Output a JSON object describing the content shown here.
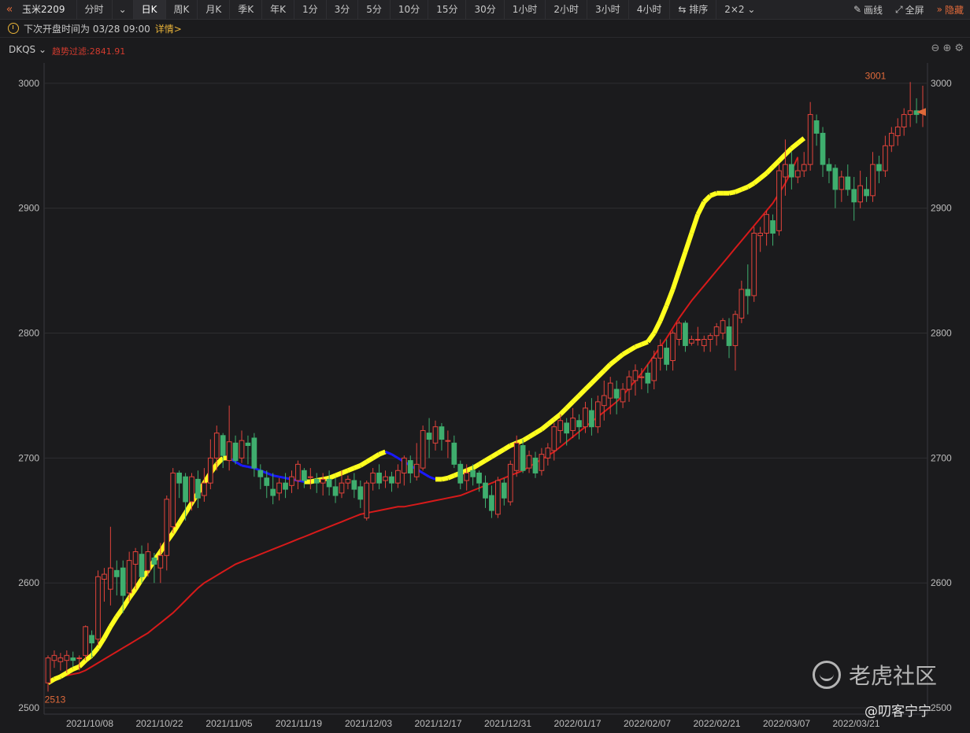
{
  "toolbar": {
    "symbol": "玉米2209",
    "tabs": [
      {
        "label": "分时"
      },
      {
        "label": "日K"
      },
      {
        "label": "周K"
      },
      {
        "label": "月K"
      },
      {
        "label": "季K"
      },
      {
        "label": "年K"
      },
      {
        "label": "1分"
      },
      {
        "label": "3分"
      },
      {
        "label": "5分"
      },
      {
        "label": "10分"
      },
      {
        "label": "15分"
      },
      {
        "label": "30分"
      },
      {
        "label": "1小时"
      },
      {
        "label": "2小时"
      },
      {
        "label": "3小时"
      },
      {
        "label": "4小时"
      },
      {
        "label": "排序"
      },
      {
        "label": "2×2"
      }
    ],
    "active_tab": "日K",
    "draw_label": "画线",
    "fullscreen_label": "全屏",
    "hide_label": "隐藏"
  },
  "info_bar": {
    "next_open": "下次开盘时间为 03/28 09:00",
    "detail_link": "详情>"
  },
  "indicator": {
    "name": "DKQS",
    "trend_filter": "趋势过滤:2841.91"
  },
  "watermark": {
    "brand": "老虎社区",
    "user": "@叨客宁宁"
  },
  "colors": {
    "up": "#e2433b",
    "down": "#3fae6e",
    "ma": "#d71a1a",
    "trend_up": "#ffff1e",
    "trend_down": "#1a1aff",
    "grid": "#2e2e31",
    "accent": "#e06a3a"
  },
  "chart_data": {
    "type": "candlestick",
    "y_ticks": [
      2500,
      2600,
      2700,
      2800,
      2900,
      3000
    ],
    "ylim": [
      2495,
      3010
    ],
    "x_tick_labels": [
      "2021/10/08",
      "2021/10/22",
      "2021/11/05",
      "2021/11/19",
      "2021/12/03",
      "2021/12/17",
      "2021/12/31",
      "2022/01/17",
      "2022/02/07",
      "2022/02/21",
      "2022/03/07",
      "2022/03/21"
    ],
    "high_label": "3001",
    "low_label": "2513",
    "last_price": 2977,
    "candles": [
      [
        2520,
        2540,
        2513,
        2542
      ],
      [
        2538,
        2542,
        2532,
        2546
      ],
      [
        2537,
        2540,
        2530,
        2544
      ],
      [
        2538,
        2542,
        2528,
        2546
      ],
      [
        2540,
        2538,
        2533,
        2545
      ],
      [
        2540,
        2540,
        2530,
        2542
      ],
      [
        2542,
        2565,
        2538,
        2566
      ],
      [
        2558,
        2552,
        2540,
        2562
      ],
      [
        2555,
        2605,
        2550,
        2610
      ],
      [
        2603,
        2607,
        2585,
        2612
      ],
      [
        2595,
        2612,
        2582,
        2645
      ],
      [
        2610,
        2605,
        2590,
        2618
      ],
      [
        2612,
        2590,
        2576,
        2618
      ],
      [
        2592,
        2618,
        2585,
        2625
      ],
      [
        2615,
        2625,
        2595,
        2628
      ],
      [
        2623,
        2605,
        2600,
        2630
      ],
      [
        2610,
        2625,
        2605,
        2632
      ],
      [
        2620,
        2615,
        2600,
        2624
      ],
      [
        2612,
        2622,
        2600,
        2632
      ],
      [
        2622,
        2667,
        2610,
        2670
      ],
      [
        2645,
        2688,
        2640,
        2692
      ],
      [
        2688,
        2680,
        2668,
        2690
      ],
      [
        2685,
        2665,
        2650,
        2688
      ],
      [
        2665,
        2685,
        2658,
        2688
      ],
      [
        2683,
        2668,
        2660,
        2690
      ],
      [
        2670,
        2680,
        2665,
        2692
      ],
      [
        2680,
        2700,
        2675,
        2715
      ],
      [
        2700,
        2720,
        2690,
        2726
      ],
      [
        2718,
        2702,
        2692,
        2720
      ],
      [
        2698,
        2713,
        2690,
        2742
      ],
      [
        2712,
        2698,
        2695,
        2718
      ],
      [
        2700,
        2714,
        2696,
        2722
      ],
      [
        2712,
        2710,
        2695,
        2718
      ],
      [
        2716,
        2692,
        2685,
        2720
      ],
      [
        2690,
        2685,
        2675,
        2695
      ],
      [
        2684,
        2678,
        2668,
        2690
      ],
      [
        2675,
        2670,
        2663,
        2688
      ],
      [
        2672,
        2680,
        2666,
        2684
      ],
      [
        2680,
        2675,
        2668,
        2688
      ],
      [
        2678,
        2685,
        2672,
        2690
      ],
      [
        2682,
        2695,
        2675,
        2698
      ],
      [
        2690,
        2682,
        2676,
        2692
      ],
      [
        2685,
        2685,
        2675,
        2692
      ],
      [
        2683,
        2680,
        2672,
        2688
      ],
      [
        2680,
        2683,
        2670,
        2688
      ],
      [
        2683,
        2677,
        2670,
        2690
      ],
      [
        2677,
        2670,
        2664,
        2684
      ],
      [
        2672,
        2680,
        2668,
        2690
      ],
      [
        2680,
        2683,
        2675,
        2686
      ],
      [
        2682,
        2675,
        2668,
        2688
      ],
      [
        2677,
        2667,
        2660,
        2682
      ],
      [
        2652,
        2680,
        2650,
        2682
      ],
      [
        2680,
        2688,
        2674,
        2692
      ],
      [
        2688,
        2680,
        2675,
        2695
      ],
      [
        2682,
        2685,
        2676,
        2690
      ],
      [
        2685,
        2680,
        2673,
        2689
      ],
      [
        2680,
        2690,
        2676,
        2695
      ],
      [
        2688,
        2700,
        2678,
        2702
      ],
      [
        2698,
        2688,
        2680,
        2702
      ],
      [
        2685,
        2695,
        2682,
        2712
      ],
      [
        2692,
        2722,
        2690,
        2726
      ],
      [
        2720,
        2715,
        2700,
        2732
      ],
      [
        2712,
        2725,
        2706,
        2730
      ],
      [
        2725,
        2715,
        2706,
        2728
      ],
      [
        2714,
        2714,
        2700,
        2722
      ],
      [
        2712,
        2695,
        2692,
        2718
      ],
      [
        2695,
        2680,
        2675,
        2698
      ],
      [
        2682,
        2688,
        2674,
        2695
      ],
      [
        2690,
        2685,
        2678,
        2695
      ],
      [
        2688,
        2680,
        2673,
        2690
      ],
      [
        2680,
        2668,
        2660,
        2686
      ],
      [
        2670,
        2658,
        2652,
        2678
      ],
      [
        2655,
        2682,
        2652,
        2685
      ],
      [
        2680,
        2668,
        2662,
        2684
      ],
      [
        2665,
        2695,
        2662,
        2698
      ],
      [
        2690,
        2712,
        2685,
        2718
      ],
      [
        2710,
        2690,
        2688,
        2715
      ],
      [
        2692,
        2702,
        2688,
        2706
      ],
      [
        2700,
        2688,
        2684,
        2705
      ],
      [
        2690,
        2703,
        2686,
        2708
      ],
      [
        2700,
        2708,
        2694,
        2712
      ],
      [
        2706,
        2725,
        2698,
        2728
      ],
      [
        2722,
        2730,
        2712,
        2735
      ],
      [
        2728,
        2720,
        2710,
        2732
      ],
      [
        2722,
        2732,
        2716,
        2740
      ],
      [
        2730,
        2725,
        2715,
        2735
      ],
      [
        2725,
        2740,
        2720,
        2745
      ],
      [
        2738,
        2725,
        2718,
        2748
      ],
      [
        2725,
        2745,
        2720,
        2750
      ],
      [
        2742,
        2750,
        2730,
        2762
      ],
      [
        2748,
        2760,
        2735,
        2765
      ],
      [
        2755,
        2748,
        2735,
        2762
      ],
      [
        2745,
        2755,
        2740,
        2760
      ],
      [
        2755,
        2765,
        2745,
        2770
      ],
      [
        2762,
        2770,
        2750,
        2775
      ],
      [
        2765,
        2765,
        2755,
        2772
      ],
      [
        2768,
        2760,
        2752,
        2775
      ],
      [
        2762,
        2780,
        2755,
        2786
      ],
      [
        2780,
        2790,
        2770,
        2795
      ],
      [
        2788,
        2775,
        2770,
        2795
      ],
      [
        2778,
        2800,
        2770,
        2802
      ],
      [
        2795,
        2808,
        2790,
        2810
      ],
      [
        2808,
        2790,
        2785,
        2810
      ],
      [
        2792,
        2795,
        2790,
        2798
      ],
      [
        2795,
        2795,
        2790,
        2805
      ],
      [
        2790,
        2795,
        2785,
        2798
      ],
      [
        2795,
        2798,
        2785,
        2800
      ],
      [
        2798,
        2805,
        2790,
        2808
      ],
      [
        2800,
        2810,
        2795,
        2812
      ],
      [
        2805,
        2790,
        2780,
        2812
      ],
      [
        2790,
        2815,
        2770,
        2818
      ],
      [
        2812,
        2835,
        2808,
        2842
      ],
      [
        2835,
        2830,
        2815,
        2855
      ],
      [
        2830,
        2880,
        2825,
        2885
      ],
      [
        2878,
        2880,
        2865,
        2885
      ],
      [
        2880,
        2895,
        2870,
        2898
      ],
      [
        2890,
        2880,
        2870,
        2895
      ],
      [
        2882,
        2930,
        2878,
        2935
      ],
      [
        2925,
        2935,
        2910,
        2955
      ],
      [
        2935,
        2925,
        2915,
        2945
      ],
      [
        2925,
        2930,
        2920,
        2940
      ],
      [
        2930,
        2935,
        2925,
        2945
      ],
      [
        2935,
        2975,
        2930,
        2985
      ],
      [
        2970,
        2960,
        2950,
        2975
      ],
      [
        2960,
        2935,
        2925,
        2965
      ],
      [
        2935,
        2930,
        2920,
        2940
      ],
      [
        2932,
        2915,
        2900,
        2935
      ],
      [
        2915,
        2925,
        2905,
        2930
      ],
      [
        2925,
        2915,
        2910,
        2935
      ],
      [
        2915,
        2905,
        2890,
        2925
      ],
      [
        2905,
        2918,
        2900,
        2930
      ],
      [
        2915,
        2910,
        2905,
        2925
      ],
      [
        2910,
        2935,
        2905,
        2945
      ],
      [
        2935,
        2930,
        2920,
        2942
      ],
      [
        2930,
        2950,
        2925,
        2958
      ],
      [
        2950,
        2960,
        2945,
        2965
      ],
      [
        2958,
        2965,
        2950,
        2972
      ],
      [
        2965,
        2975,
        2958,
        2980
      ],
      [
        2975,
        2978,
        2965,
        3001
      ],
      [
        2978,
        2975,
        2968,
        2988
      ],
      [
        2976,
        2978,
        2965,
        2998
      ]
    ],
    "trend": [
      2520,
      2523,
      2525,
      2528,
      2531,
      2533,
      2538,
      2542,
      2548,
      2556,
      2565,
      2573,
      2580,
      2588,
      2595,
      2603,
      2610,
      2618,
      2625,
      2633,
      2640,
      2648,
      2656,
      2664,
      2672,
      2680,
      2688,
      2695,
      2700,
      2700,
      2697,
      2694,
      2693,
      2692,
      2690,
      2688,
      2686,
      2685,
      2684,
      2683,
      2682,
      2681,
      2681,
      2682,
      2683,
      2684,
      2686,
      2688,
      2690,
      2692,
      2694,
      2697,
      2700,
      2703,
      2705,
      2703,
      2700,
      2697,
      2694,
      2691,
      2688,
      2685,
      2683,
      2683,
      2684,
      2686,
      2688,
      2690,
      2692,
      2695,
      2698,
      2701,
      2704,
      2707,
      2710,
      2712,
      2714,
      2717,
      2720,
      2723,
      2727,
      2731,
      2735,
      2740,
      2745,
      2750,
      2755,
      2760,
      2765,
      2770,
      2775,
      2779,
      2783,
      2786,
      2789,
      2791,
      2793,
      2800,
      2810,
      2822,
      2835,
      2850,
      2865,
      2880,
      2895,
      2905,
      2910,
      2912,
      2912,
      2912,
      2913,
      2915,
      2917,
      2920,
      2924,
      2928,
      2933,
      2938,
      2943,
      2948,
      2952,
      2956
    ],
    "ma": [
      2520,
      2523,
      2525,
      2526,
      2527,
      2528,
      2530,
      2533,
      2536,
      2539,
      2542,
      2545,
      2548,
      2551,
      2554,
      2557,
      2560,
      2564,
      2568,
      2572,
      2576,
      2581,
      2586,
      2591,
      2596,
      2600,
      2603,
      2606,
      2609,
      2612,
      2615,
      2617,
      2619,
      2621,
      2623,
      2625,
      2627,
      2629,
      2631,
      2633,
      2635,
      2637,
      2639,
      2641,
      2643,
      2645,
      2647,
      2649,
      2651,
      2653,
      2655,
      2656,
      2657,
      2658,
      2659,
      2660,
      2661,
      2661,
      2662,
      2663,
      2664,
      2665,
      2666,
      2667,
      2668,
      2669,
      2670,
      2672,
      2674,
      2676,
      2678,
      2680,
      2682,
      2684,
      2686,
      2688,
      2690,
      2693,
      2696,
      2699,
      2702,
      2705,
      2709,
      2713,
      2717,
      2721,
      2725,
      2729,
      2733,
      2737,
      2741,
      2745,
      2750,
      2756,
      2762,
      2768,
      2775,
      2782,
      2789,
      2796,
      2804,
      2812,
      2819,
      2826,
      2832,
      2838,
      2844,
      2850,
      2856,
      2862,
      2868,
      2874,
      2880,
      2886,
      2892,
      2898,
      2904,
      2912,
      2920,
      2930,
      2941
    ]
  }
}
